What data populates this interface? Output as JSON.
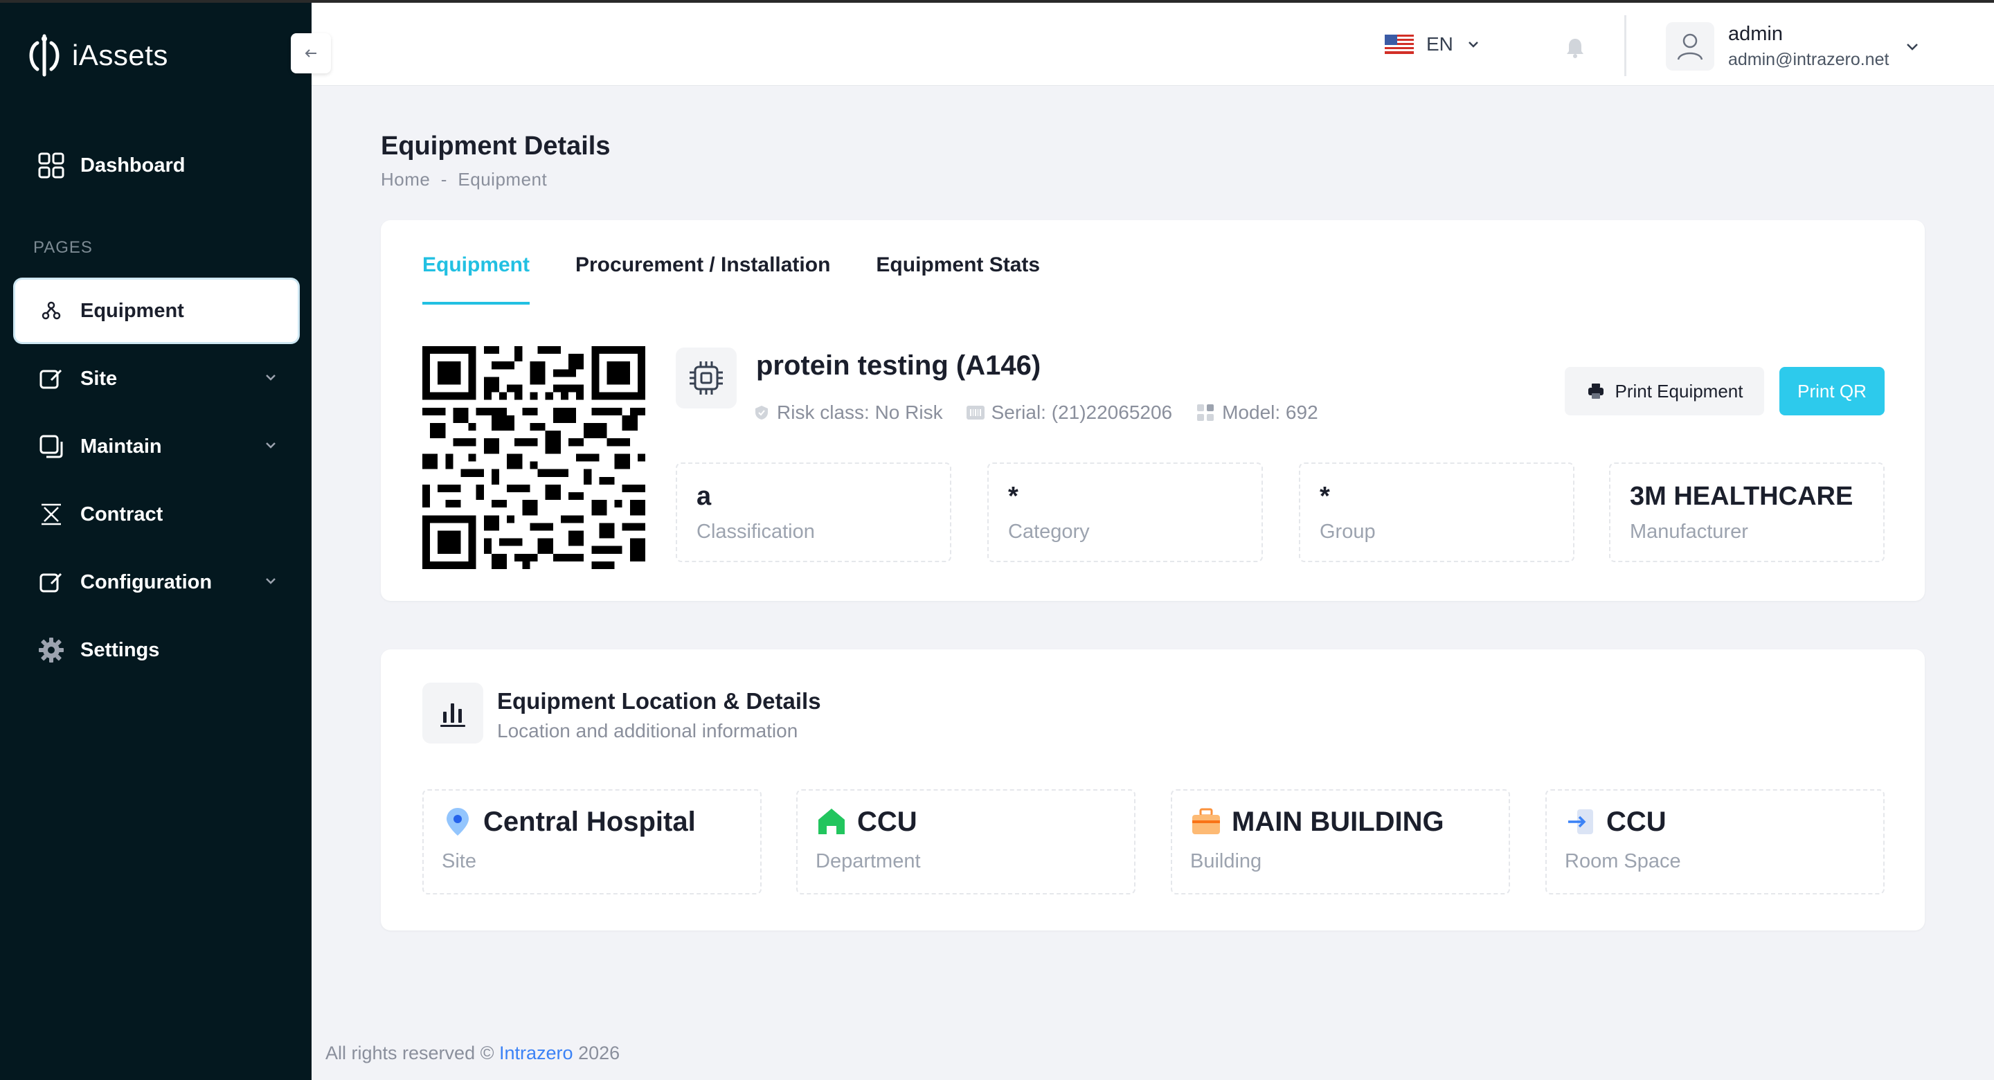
{
  "app": {
    "name": "iAssets"
  },
  "sidebar": {
    "pages_label": "PAGES",
    "items": [
      {
        "label": "Dashboard",
        "icon": "grid-icon"
      },
      {
        "label": "Equipment",
        "icon": "equipment-icon",
        "active": true
      },
      {
        "label": "Site",
        "icon": "edit-icon",
        "has_submenu": true
      },
      {
        "label": "Maintain",
        "icon": "copy-icon",
        "has_submenu": true
      },
      {
        "label": "Contract",
        "icon": "contract-icon"
      },
      {
        "label": "Configuration",
        "icon": "edit-icon",
        "has_submenu": true
      },
      {
        "label": "Settings",
        "icon": "gear-icon"
      }
    ]
  },
  "header": {
    "language": "EN",
    "user": {
      "name": "admin",
      "email": "admin@intrazero.net"
    }
  },
  "page": {
    "title": "Equipment Details",
    "breadcrumb": "Home  -  Equipment"
  },
  "equipment": {
    "tabs": [
      "Equipment",
      "Procurement / Installation",
      "Equipment Stats"
    ],
    "name": "protein testing (A146)",
    "risk": "Risk class: No Risk",
    "serial": "Serial: (21)22065206",
    "model": "Model: 692",
    "print_equipment_label": "Print Equipment",
    "print_qr_label": "Print QR",
    "info": [
      {
        "value": "a",
        "label": "Classification"
      },
      {
        "value": "*",
        "label": "Category"
      },
      {
        "value": "*",
        "label": "Group"
      },
      {
        "value": "3M HEALTHCARE",
        "label": "Manufacturer"
      }
    ]
  },
  "location": {
    "title": "Equipment Location & Details",
    "subtitle": "Location and additional information",
    "items": [
      {
        "value": "Central Hospital",
        "label": "Site",
        "icon": "map-pin-icon"
      },
      {
        "value": "CCU",
        "label": "Department",
        "icon": "home-icon"
      },
      {
        "value": "MAIN BUILDING",
        "label": "Building",
        "icon": "briefcase-icon"
      },
      {
        "value": "CCU",
        "label": "Room Space",
        "icon": "enter-icon"
      }
    ]
  },
  "footer": {
    "prefix": "All rights reserved ©",
    "brand": "Intrazero",
    "year": "2026"
  },
  "colors": {
    "sidebar": "#04181f",
    "accent": "#22c0e2",
    "button_primary": "#2dcaec",
    "link": "#3b82f6"
  }
}
